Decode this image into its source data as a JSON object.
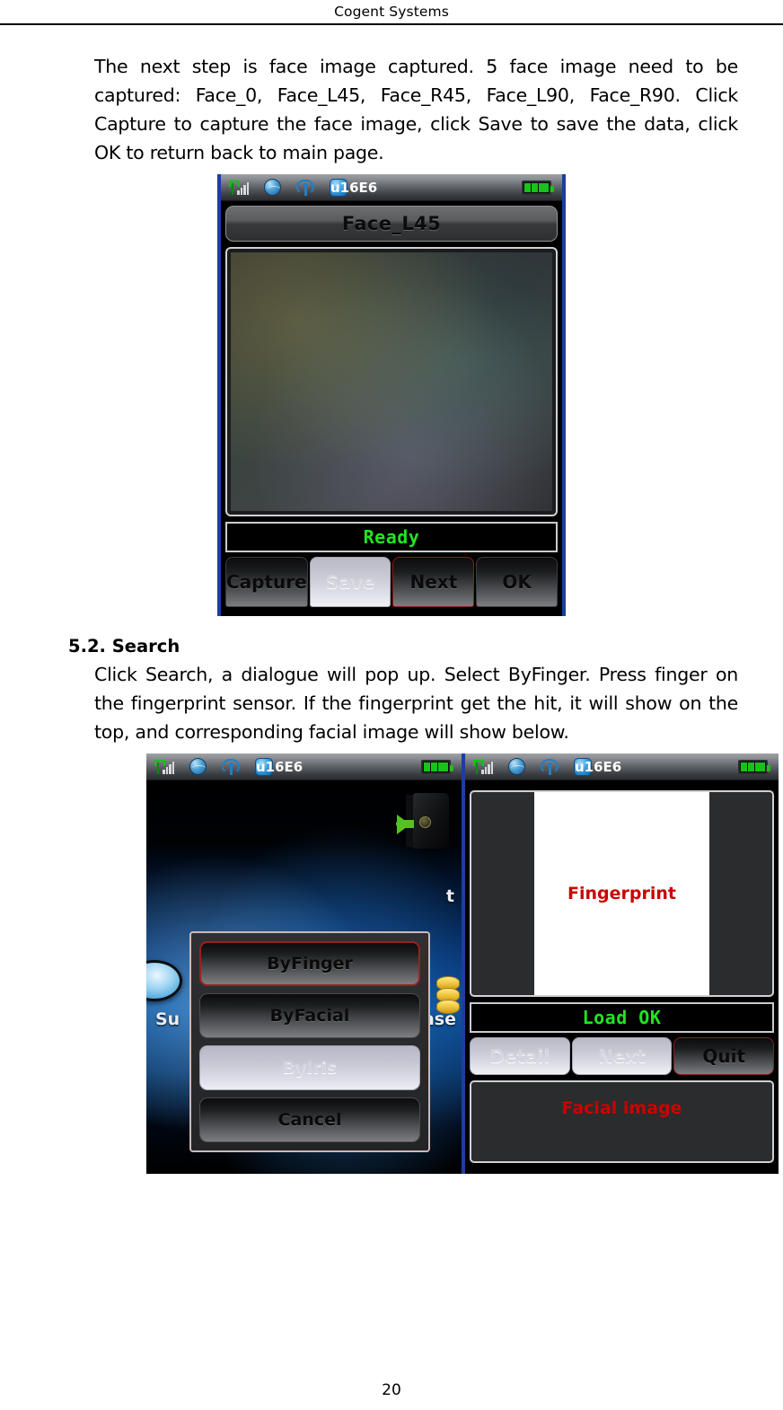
{
  "header": {
    "title": "Cogent Systems"
  },
  "page_number": "20",
  "body": {
    "para1": "The next step is face image captured. 5 face image need to be captured: Face_0, Face_L45, Face_R45, Face_L90, Face_R90. Click Capture to capture the face image, click Save to save the data, click OK to return back to main page.",
    "section_number_title": "5.2. Search",
    "para2": "Click Search, a dialogue will pop up. Select ByFinger. Press finger on the fingerprint sensor. If the fingerprint get the hit, it will show on the top, and corresponding facial image will show below."
  },
  "figure_face_capture": {
    "statusbar": {
      "signal_icon": "signal-bars-icon",
      "globe_icon": "globe-icon",
      "gps_icon": "gps-icon",
      "bluetooth_icon": "bluetooth-icon",
      "battery_icon": "battery-icon"
    },
    "title": "Face_L45",
    "status_text": "Ready",
    "buttons": [
      {
        "label": "Capture",
        "state": "normal"
      },
      {
        "label": "Save",
        "state": "disabled"
      },
      {
        "label": "Next",
        "state": "focused"
      },
      {
        "label": "OK",
        "state": "normal"
      }
    ]
  },
  "figure_search": {
    "left_device": {
      "wallpaper_text": {
        "left": "Su",
        "right": "ase",
        "top_right": "t"
      },
      "exit_icon": "exit-door-icon",
      "coins_icon": "coins-icon",
      "orb_icon": "orb-icon",
      "dialog_options": [
        {
          "label": "ByFinger",
          "state": "focused"
        },
        {
          "label": "ByFacial",
          "state": "normal"
        },
        {
          "label": "ByIris",
          "state": "disabled"
        },
        {
          "label": "Cancel",
          "state": "normal"
        }
      ]
    },
    "right_device": {
      "fingerprint_label": "Fingerprint",
      "status_text": "Load OK",
      "buttons": [
        {
          "label": "Detail",
          "state": "disabled"
        },
        {
          "label": "Next",
          "state": "disabled"
        },
        {
          "label": "Quit",
          "state": "focused"
        }
      ],
      "facial_label": "Facial image"
    }
  },
  "colors": {
    "status_green": "#21e521",
    "focus_red": "#9c1f1f",
    "label_red": "#cc0000",
    "image_border_blue": "#1a3fa0"
  }
}
